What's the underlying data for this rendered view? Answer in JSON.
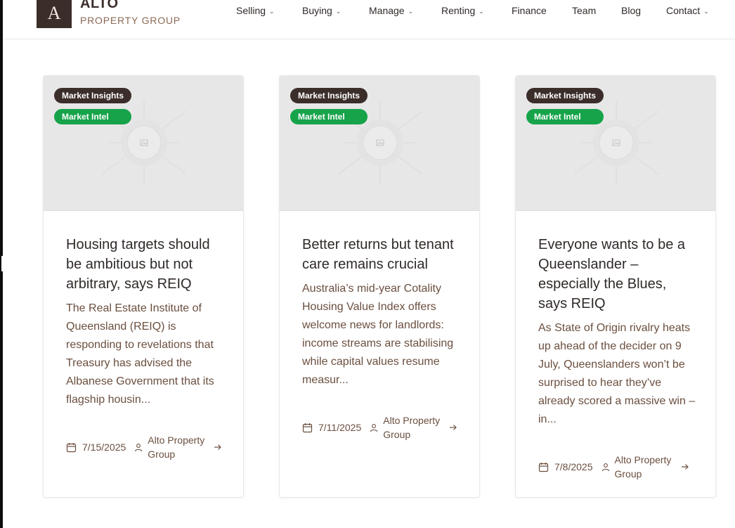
{
  "brand": {
    "logo_letter": "A",
    "name": "ALTO",
    "subtitle": "PROPERTY GROUP",
    "colors": {
      "primary": "#3a2d2a",
      "accent": "#16a34a",
      "text_brown": "#6b4f3f"
    }
  },
  "nav": {
    "items": [
      {
        "label": "Selling",
        "has_dropdown": true
      },
      {
        "label": "Buying",
        "has_dropdown": true
      },
      {
        "label": "Manage",
        "has_dropdown": true
      },
      {
        "label": "Renting",
        "has_dropdown": true
      },
      {
        "label": "Finance",
        "has_dropdown": false
      },
      {
        "label": "Team",
        "has_dropdown": false
      },
      {
        "label": "Blog",
        "has_dropdown": false
      },
      {
        "label": "Contact",
        "has_dropdown": true
      }
    ],
    "chevron": "⌄"
  },
  "posts": [
    {
      "category": "Market Insights",
      "tag": "Market Intel",
      "title": "Housing targets should be ambitious but not arbitrary, says REIQ",
      "excerpt": "The Real Estate Institute of Queensland (REIQ) is responding to revelations that Treasury has advised the Albanese Government that its flagship housin...",
      "date": "7/15/2025",
      "author": "Alto Property Group"
    },
    {
      "category": "Market Insights",
      "tag": "Market Intel",
      "title": "Better returns but tenant care remains crucial",
      "excerpt": "Australia’s mid-year Cotality Housing Value Index offers welcome news for landlords: income streams are stabilising while capital values resume measur...",
      "date": "7/11/2025",
      "author": "Alto Property Group"
    },
    {
      "category": "Market Insights",
      "tag": "Market Intel",
      "title": "Everyone wants to be a Queenslander – especially the Blues, says REIQ",
      "excerpt": "As State of Origin rivalry heats up ahead of the decider on 9 July, Queenslanders won’t be surprised to hear they’ve already scored a massive win – in...",
      "date": "7/8/2025",
      "author": "Alto Property Group"
    }
  ],
  "icons": {
    "date": "calendar-icon",
    "author": "user-icon",
    "read_more": "arrow-right-icon",
    "thumbnail": "image-placeholder-icon"
  }
}
